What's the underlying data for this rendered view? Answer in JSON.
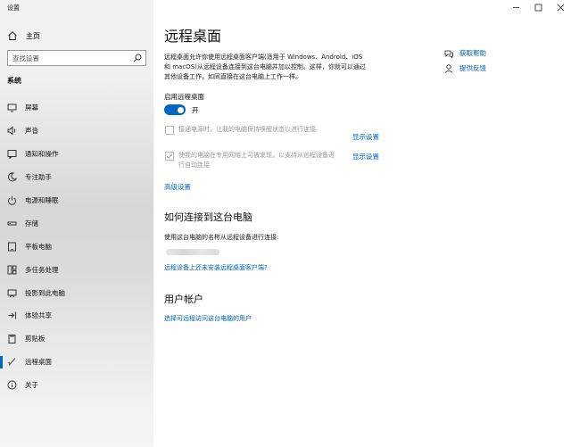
{
  "window": {
    "title": "设置",
    "controls": [
      "minimize-icon",
      "maximize-icon",
      "close-icon"
    ]
  },
  "sidebar": {
    "home_label": "主页",
    "search_placeholder": "查找设置",
    "section_label": "系统",
    "items": [
      {
        "label": "屏幕",
        "icon": "monitor-icon"
      },
      {
        "label": "声音",
        "icon": "speaker-icon"
      },
      {
        "label": "通知和操作",
        "icon": "notification-icon"
      },
      {
        "label": "专注助手",
        "icon": "moon-icon"
      },
      {
        "label": "电源和睡眠",
        "icon": "power-icon"
      },
      {
        "label": "存储",
        "icon": "storage-icon"
      },
      {
        "label": "平板电脑",
        "icon": "tablet-icon"
      },
      {
        "label": "多任务处理",
        "icon": "multitask-icon"
      },
      {
        "label": "投影到此电脑",
        "icon": "project-icon"
      },
      {
        "label": "体验共享",
        "icon": "share-icon"
      },
      {
        "label": "剪贴板",
        "icon": "clipboard-icon"
      },
      {
        "label": "远程桌面",
        "icon": "remote-desktop-icon",
        "active": true
      },
      {
        "label": "关于",
        "icon": "info-icon"
      }
    ]
  },
  "main": {
    "title": "远程桌面",
    "description_lines": [
      "远程桌面允许你使用远程桌面客户端(适用于 Windows、Android、iOS",
      "和 macOS)从远程设备连接到这台电脑并加以控制。这样，你就可以通过",
      "其他设备工作，如同直接在这台电脑上工作一样。"
    ],
    "enable_label": "启用远程桌面",
    "toggle_state": "开",
    "toggle_on": true,
    "option1": {
      "lines": [
        "接通电源时，让我的电脑保持唤醒状态以进行连接"
      ],
      "checked": false,
      "link": "显示设置"
    },
    "option2": {
      "lines": [
        "使我的电脑在专用网络上可被发现，以支持从远程设备进",
        "行自动连接"
      ],
      "checked": true,
      "link": "显示设置"
    },
    "advanced_link": "高级设置",
    "how_to_connect": {
      "heading": "如何连接到这台电脑",
      "text": "使用这台电脑的名称从远程设备进行连接:",
      "link": "远程设备上还未安装远程桌面客户端?"
    },
    "user_accounts": {
      "heading": "用户帐户",
      "link": "选择可远程访问这台电脑的用户"
    }
  },
  "help": {
    "get_help": "获取帮助",
    "feedback": "提供反馈"
  },
  "colors": {
    "accent": "#0067c0",
    "disabled_text": "#9a9a9a"
  }
}
